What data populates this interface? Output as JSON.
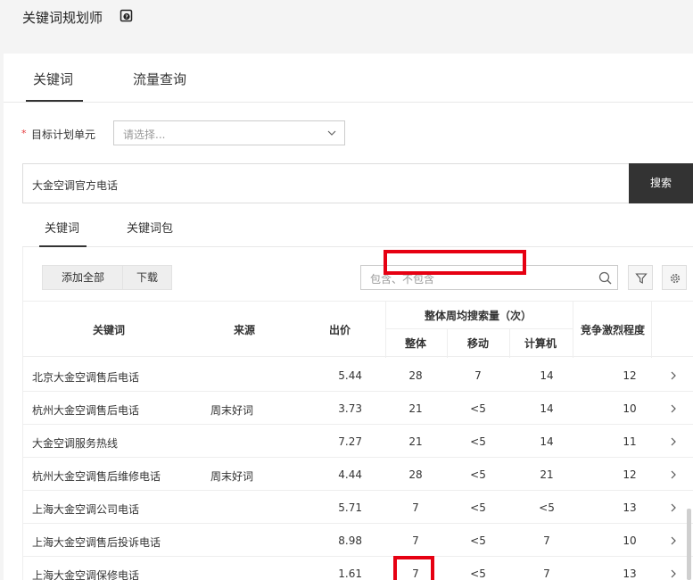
{
  "app": {
    "title": "关键词规划师",
    "help_icon": "help-book-icon"
  },
  "main_tabs": [
    {
      "label": "关键词",
      "active": true
    },
    {
      "label": "流量查询",
      "active": false
    }
  ],
  "unit": {
    "required_mark": "*",
    "label": "目标计划单元",
    "placeholder": "请选择..."
  },
  "search": {
    "value": "大金空调官方电话",
    "button_label": "搜索"
  },
  "sub_tabs": [
    {
      "label": "关键词",
      "active": true
    },
    {
      "label": "关键词包",
      "active": false
    }
  ],
  "toolbar": {
    "add_all_label": "添加全部",
    "download_label": "下载",
    "filter_placeholder": "包含、不包含"
  },
  "columns": {
    "keyword": "关键词",
    "source": "来源",
    "bid": "出价",
    "weekly_search_group": "整体周均搜索量（次）",
    "overall": "整体",
    "mobile": "移动",
    "pc": "计算机",
    "competition": "竞争激烈程度"
  },
  "rows": [
    {
      "keyword": "北京大金空调售后电话",
      "source": "",
      "bid": "5.44",
      "overall": "28",
      "mobile": "7",
      "pc": "14",
      "competition": "12"
    },
    {
      "keyword": "杭州大金空调售后电话",
      "source": "周末好词",
      "bid": "3.73",
      "overall": "21",
      "mobile": "<5",
      "pc": "14",
      "competition": "10"
    },
    {
      "keyword": "大金空调服务热线",
      "source": "",
      "bid": "7.27",
      "overall": "21",
      "mobile": "<5",
      "pc": "14",
      "competition": "11"
    },
    {
      "keyword": "杭州大金空调售后维修电话",
      "source": "周末好词",
      "bid": "4.44",
      "overall": "28",
      "mobile": "<5",
      "pc": "21",
      "competition": "12"
    },
    {
      "keyword": "上海大金空调公司电话",
      "source": "",
      "bid": "5.71",
      "overall": "7",
      "mobile": "<5",
      "pc": "<5",
      "competition": "13"
    },
    {
      "keyword": "上海大金空调售后投诉电话",
      "source": "",
      "bid": "8.98",
      "overall": "7",
      "mobile": "<5",
      "pc": "7",
      "competition": "10"
    },
    {
      "keyword": "上海大金空调保修电话",
      "source": "",
      "bid": "1.61",
      "overall": "7",
      "mobile": "<5",
      "pc": "7",
      "competition": "13"
    }
  ],
  "colors": {
    "highlight": "#e60012",
    "dark_button": "#333333"
  }
}
